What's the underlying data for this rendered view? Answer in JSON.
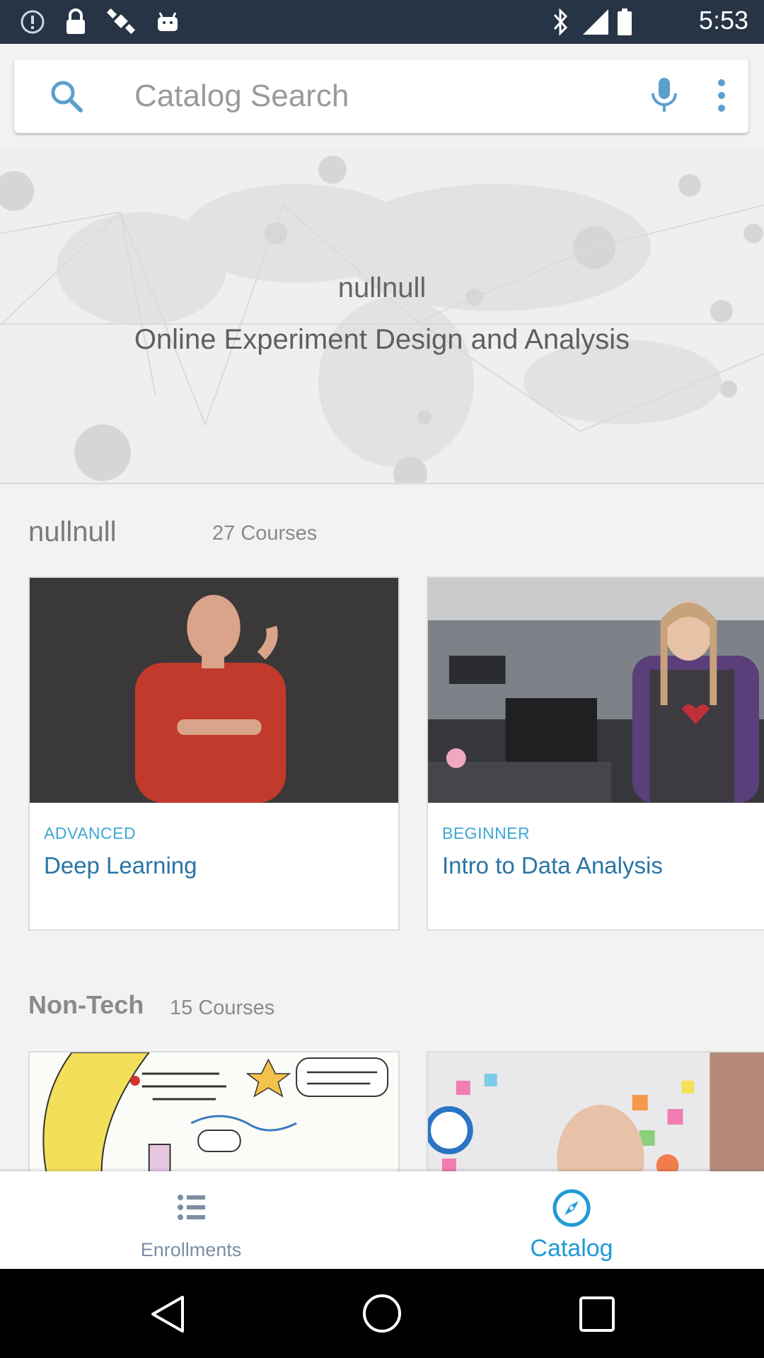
{
  "status_bar": {
    "time": "5:53",
    "icons": [
      "info-icon",
      "lock-icon",
      "satellite-icon",
      "android-icon",
      "bluetooth-icon",
      "signal-icon",
      "battery-icon"
    ]
  },
  "search": {
    "placeholder": "Catalog Search",
    "search_icon": "search-icon",
    "mic_icon": "mic-icon",
    "more_icon": "more-vertical-icon"
  },
  "banner": {
    "title": "nullnull",
    "subtitle": "Online Experiment Design and Analysis"
  },
  "sections": [
    {
      "title": "nullnull",
      "count": "27 Courses",
      "courses": [
        {
          "level": "ADVANCED",
          "title": "Deep Learning"
        },
        {
          "level": "BEGINNER",
          "title": "Intro to Data Analysis"
        }
      ]
    },
    {
      "title": "Non-Tech",
      "count": "15 Courses",
      "courses": [
        {
          "level": "",
          "title": ""
        },
        {
          "level": "",
          "title": ""
        }
      ]
    }
  ],
  "bottom_nav": {
    "items": [
      {
        "label": "Enrollments",
        "icon": "list-icon",
        "active": false
      },
      {
        "label": "Catalog",
        "icon": "compass-icon",
        "active": true
      }
    ]
  },
  "colors": {
    "status_bar": "#263445",
    "accent": "#1f9ad6",
    "course_title": "#2a74a6",
    "course_level": "#3ea6d6"
  }
}
